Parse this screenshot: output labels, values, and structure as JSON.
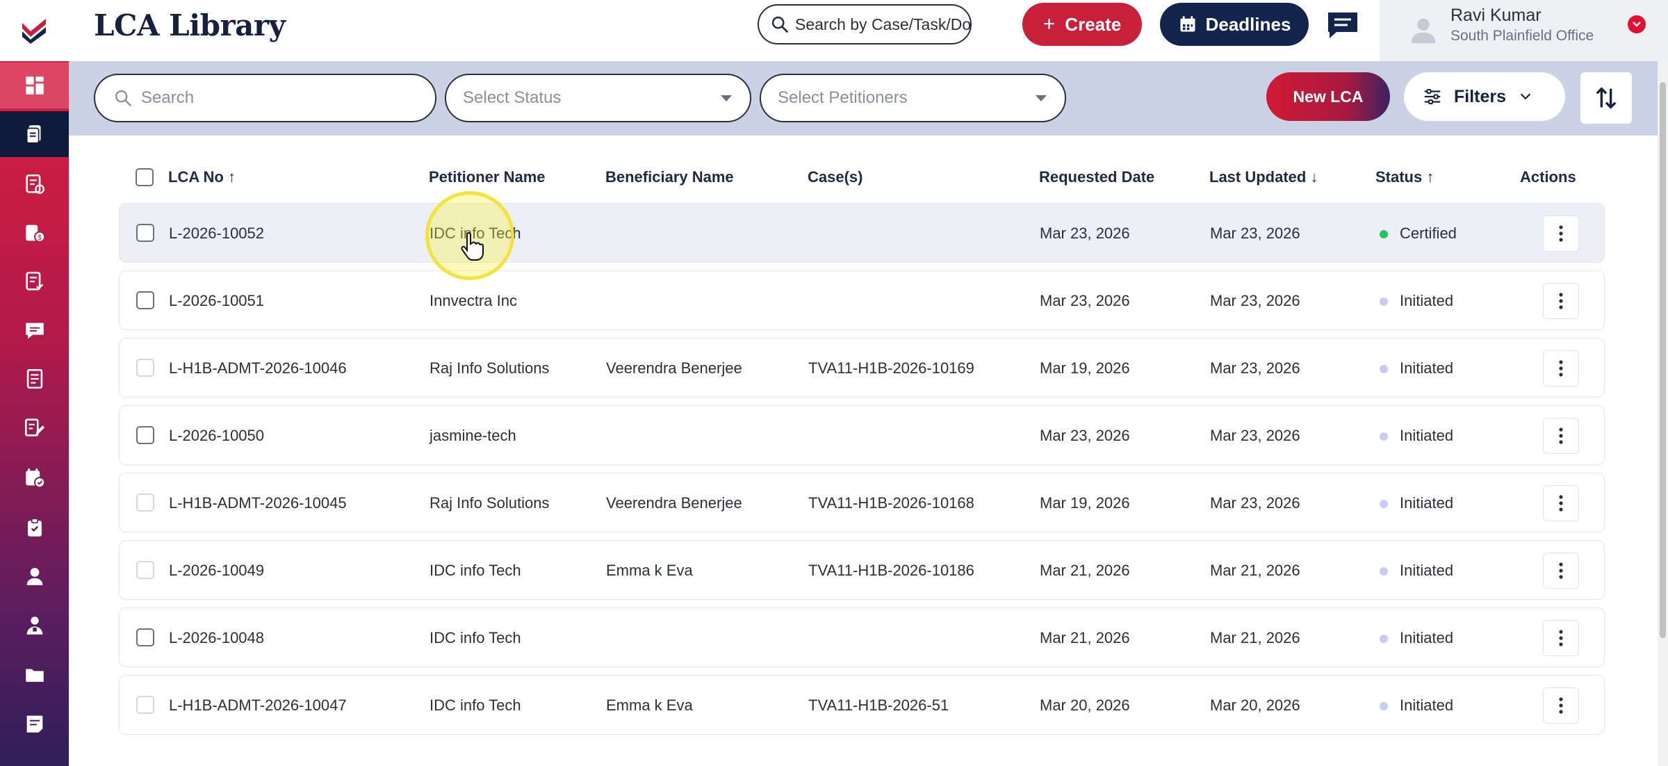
{
  "app": {
    "title": "LCA Library"
  },
  "header": {
    "search_placeholder": "Search by Case/Task/Docu",
    "create_label": "Create",
    "create_icon": "+",
    "deadlines_label": "Deadlines",
    "user": {
      "name": "Ravi Kumar",
      "office": "South Plainfield Office"
    }
  },
  "sidebar": {
    "items": [
      {
        "icon": "dashboard-icon"
      },
      {
        "icon": "lca-library-icon"
      },
      {
        "icon": "document-check-icon"
      },
      {
        "icon": "document-money-icon"
      },
      {
        "icon": "document-approved-icon"
      },
      {
        "icon": "messages-icon"
      },
      {
        "icon": "ledger-icon"
      },
      {
        "icon": "edit-list-icon"
      },
      {
        "icon": "calendar-check-icon"
      },
      {
        "icon": "clipboard-icon"
      },
      {
        "icon": "user-icon"
      },
      {
        "icon": "team-icon"
      },
      {
        "icon": "folder-icon"
      },
      {
        "icon": "notes-icon"
      }
    ]
  },
  "filters": {
    "search_placeholder": "Search",
    "status_placeholder": "Select Status",
    "petitioners_placeholder": "Select Petitioners",
    "new_lca_label": "New LCA",
    "filters_label": "Filters"
  },
  "table": {
    "headers": {
      "lca_no": "LCA No",
      "lca_no_sort": "↑",
      "petitioner": "Petitioner Name",
      "beneficiary": "Beneficiary Name",
      "cases": "Case(s)",
      "requested": "Requested Date",
      "updated": "Last Updated",
      "updated_sort": "↓",
      "status": "Status",
      "status_sort": "↑",
      "actions": "Actions"
    },
    "rows": [
      {
        "lca_no": "L-2026-10052",
        "petitioner": "IDC info Tech",
        "beneficiary": "",
        "cases": "",
        "requested": "Mar 23, 2026",
        "updated": "Mar 23, 2026",
        "status": "Certified"
      },
      {
        "lca_no": "L-2026-10051",
        "petitioner": "Innvectra Inc",
        "beneficiary": "",
        "cases": "",
        "requested": "Mar 23, 2026",
        "updated": "Mar 23, 2026",
        "status": "Initiated"
      },
      {
        "lca_no": "L-H1B-ADMT-2026-10046",
        "petitioner": "Raj Info Solutions",
        "beneficiary": "Veerendra Benerjee",
        "cases": "TVA11-H1B-2026-10169",
        "requested": "Mar 19, 2026",
        "updated": "Mar 23, 2026",
        "status": "Initiated"
      },
      {
        "lca_no": "L-2026-10050",
        "petitioner": "jasmine-tech",
        "beneficiary": "",
        "cases": "",
        "requested": "Mar 23, 2026",
        "updated": "Mar 23, 2026",
        "status": "Initiated"
      },
      {
        "lca_no": "L-H1B-ADMT-2026-10045",
        "petitioner": "Raj Info Solutions",
        "beneficiary": "Veerendra Benerjee",
        "cases": "TVA11-H1B-2026-10168",
        "requested": "Mar 19, 2026",
        "updated": "Mar 23, 2026",
        "status": "Initiated"
      },
      {
        "lca_no": "L-2026-10049",
        "petitioner": "IDC info Tech",
        "beneficiary": "Emma k Eva",
        "cases": "TVA11-H1B-2026-10186",
        "requested": "Mar 21, 2026",
        "updated": "Mar 21, 2026",
        "status": "Initiated"
      },
      {
        "lca_no": "L-2026-10048",
        "petitioner": "IDC info Tech",
        "beneficiary": "",
        "cases": "",
        "requested": "Mar 21, 2026",
        "updated": "Mar 21, 2026",
        "status": "Initiated"
      },
      {
        "lca_no": "L-H1B-ADMT-2026-10047",
        "petitioner": "IDC info Tech",
        "beneficiary": "Emma k Eva",
        "cases": "TVA11-H1B-2026-51",
        "requested": "Mar 20, 2026",
        "updated": "Mar 20, 2026",
        "status": "Initiated"
      }
    ]
  },
  "colors": {
    "brand_red": "#c8203a",
    "navy": "#13254d",
    "certified": "#22c55e",
    "initiated": "#c7cdf2"
  }
}
